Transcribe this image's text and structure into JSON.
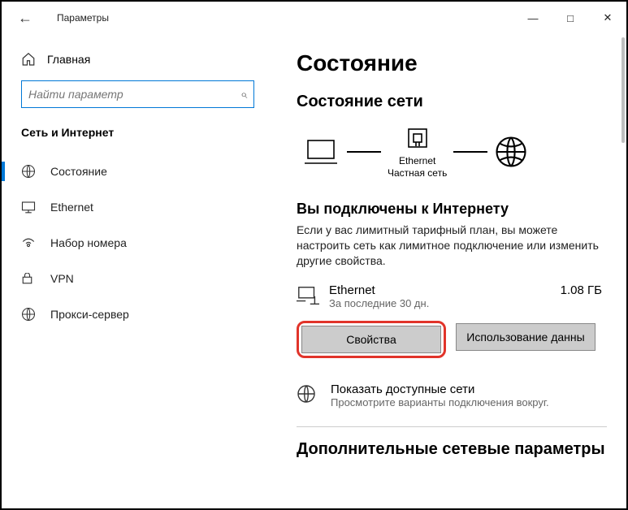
{
  "window": {
    "title": "Параметры"
  },
  "sidebar": {
    "home": "Главная",
    "search_placeholder": "Найти параметр",
    "category": "Сеть и Интернет",
    "items": [
      {
        "label": "Состояние"
      },
      {
        "label": "Ethernet"
      },
      {
        "label": "Набор номера"
      },
      {
        "label": "VPN"
      },
      {
        "label": "Прокси-сервер"
      }
    ]
  },
  "main": {
    "heading": "Состояние",
    "net_status_heading": "Состояние сети",
    "diagram": {
      "adapter": "Ethernet",
      "scope": "Частная сеть"
    },
    "connected_heading": "Вы подключены к Интернету",
    "connected_desc": "Если у вас лимитный тарифный план, вы можете настроить сеть как лимитное подключение или изменить другие свойства.",
    "connection": {
      "name": "Ethernet",
      "period": "За последние 30 дн.",
      "usage": "1.08 ГБ"
    },
    "buttons": {
      "properties": "Свойства",
      "usage": "Использование данны"
    },
    "available": {
      "title": "Показать доступные сети",
      "sub": "Просмотрите варианты подключения вокруг."
    },
    "extra_heading": "Дополнительные сетевые параметры"
  }
}
